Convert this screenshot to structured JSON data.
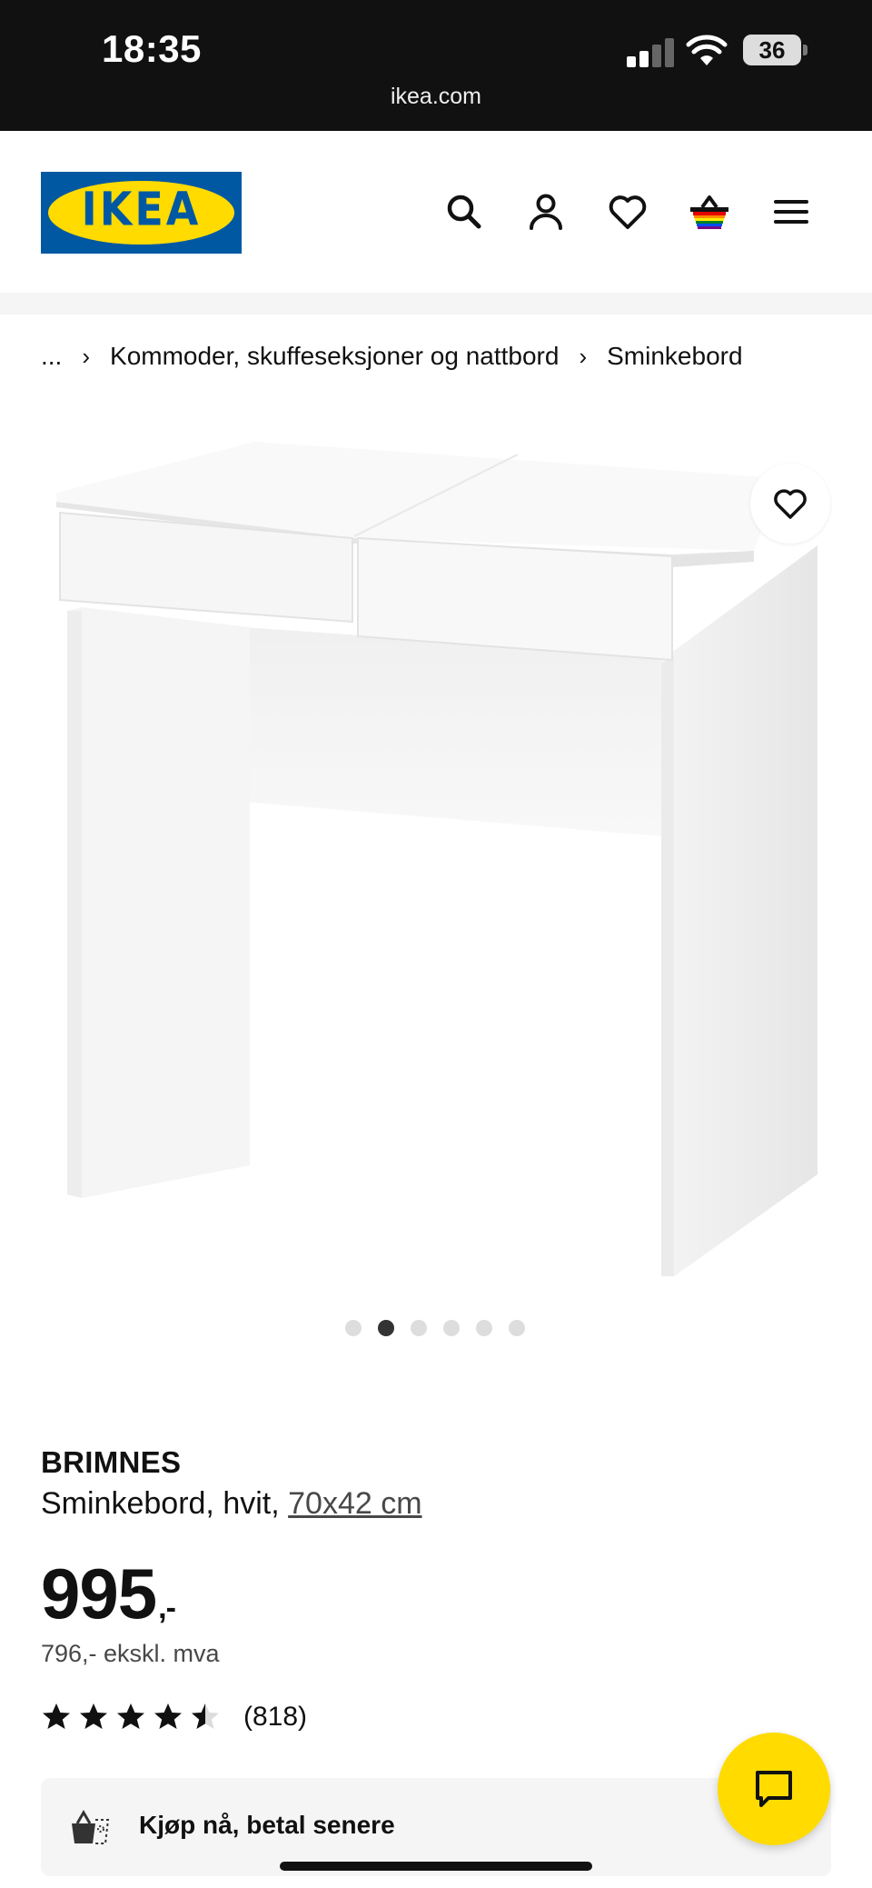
{
  "status_bar": {
    "time": "18:35",
    "battery": "36",
    "url": "ikea.com"
  },
  "header": {
    "logo_text": "IKEA",
    "brand_blue": "#0058a3",
    "brand_yellow": "#ffdb00",
    "icons": [
      "search-icon",
      "user-icon",
      "heart-icon",
      "cart-icon",
      "menu-icon"
    ]
  },
  "breadcrumb": {
    "ellipsis": "...",
    "items": [
      "Kommoder, skuffeseksjoner og nattbord",
      "Sminkebord"
    ]
  },
  "gallery": {
    "dot_count": 6,
    "active_index": 1
  },
  "product": {
    "name": "BRIMNES",
    "description": "Sminkebord, hvit,",
    "size_link": "70x42 cm",
    "price": "995",
    "price_suffix": ",-",
    "price_ex_vat": "796,- ekskl. mva",
    "rating": 4.5,
    "rating_count": "(818)"
  },
  "pay_later": {
    "label": "Kjøp nå, betal senere"
  }
}
